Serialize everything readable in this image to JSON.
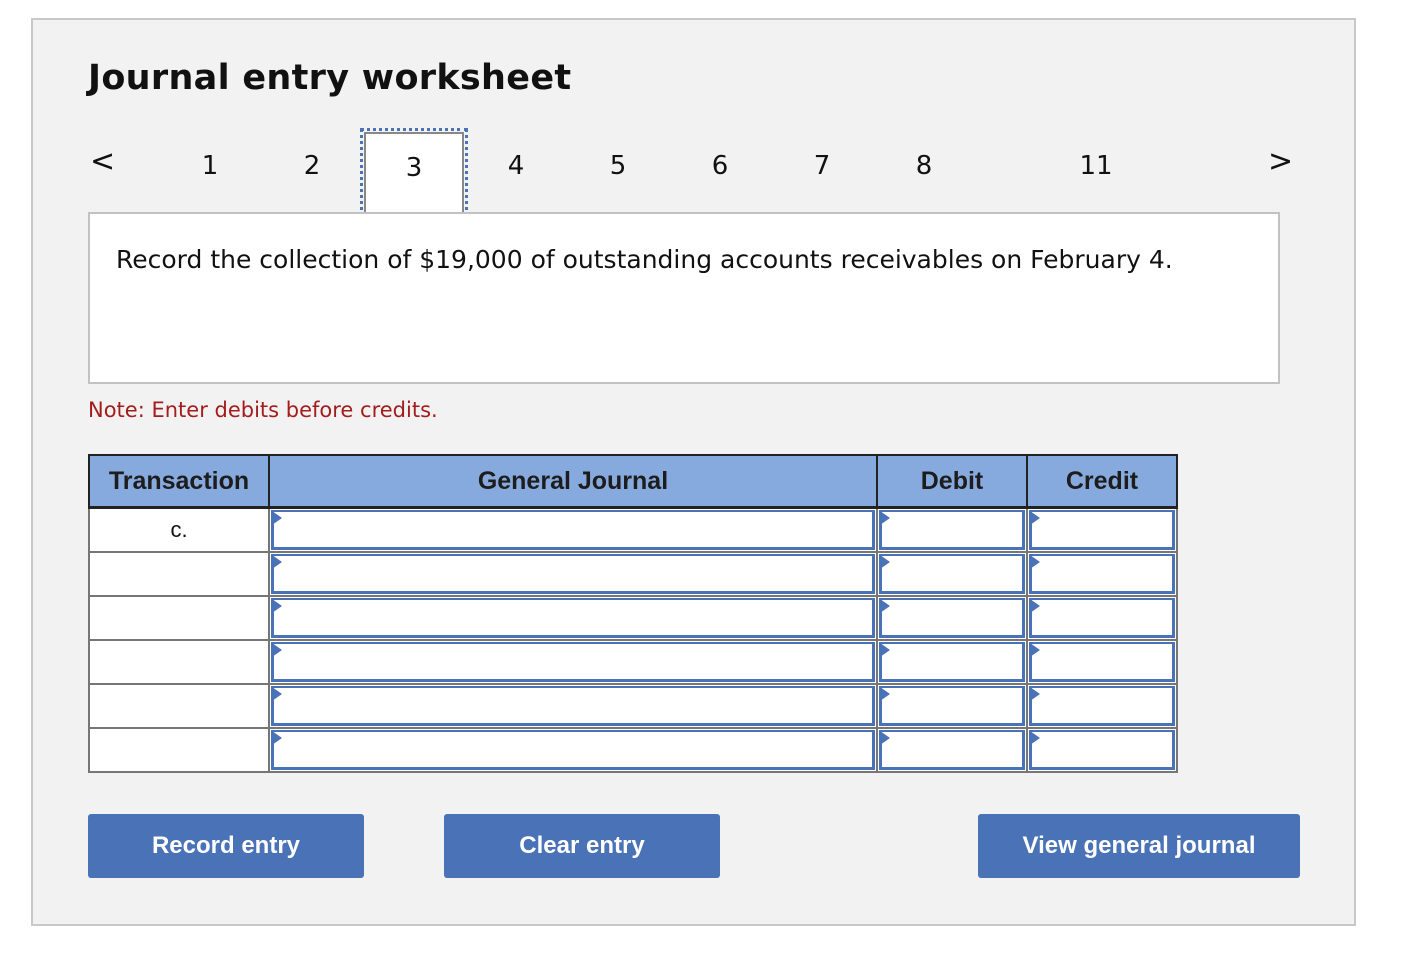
{
  "title": "Journal entry worksheet",
  "pager": {
    "prev_icon": "chevron-left-icon",
    "next_icon": "chevron-right-icon",
    "prev_glyph": "<",
    "next_glyph": ">",
    "pages": [
      "1",
      "2",
      "3",
      "4",
      "5",
      "6",
      "7",
      "8",
      "11"
    ],
    "active_page": "3"
  },
  "question": "Record the collection of $19,000 of outstanding accounts receivables on February 4.",
  "note": "Note: Enter debits before credits.",
  "table": {
    "headers": [
      "Transaction",
      "General Journal",
      "Debit",
      "Credit"
    ],
    "rows": [
      {
        "transaction": "c.",
        "account": "",
        "debit": "",
        "credit": ""
      },
      {
        "transaction": "",
        "account": "",
        "debit": "",
        "credit": ""
      },
      {
        "transaction": "",
        "account": "",
        "debit": "",
        "credit": ""
      },
      {
        "transaction": "",
        "account": "",
        "debit": "",
        "credit": ""
      },
      {
        "transaction": "",
        "account": "",
        "debit": "",
        "credit": ""
      },
      {
        "transaction": "",
        "account": "",
        "debit": "",
        "credit": ""
      }
    ]
  },
  "buttons": {
    "record": "Record entry",
    "clear": "Clear entry",
    "view": "View general journal"
  },
  "colors": {
    "accent": "#4a72b6",
    "header_bg": "#87aade",
    "note": "#a31d1d",
    "panel_bg": "#f2f2f2"
  }
}
